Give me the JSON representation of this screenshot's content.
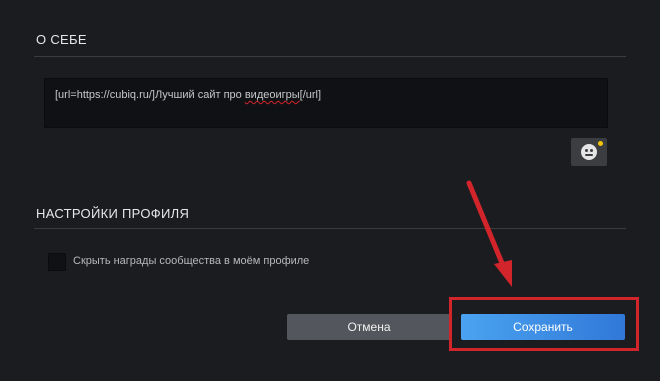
{
  "about": {
    "title": "О СЕБЕ",
    "bio_prefix": "[url=https://cubiq.ru/]Лучший сайт про ",
    "bio_underlined": "видеоигры",
    "bio_suffix": "[/url]"
  },
  "profile_settings": {
    "title": "НАСТРОЙКИ ПРОФИЛЯ",
    "hide_awards_label": "Скрыть награды сообщества в моём профиле",
    "hide_awards_checked": false
  },
  "actions": {
    "cancel_label": "Отмена",
    "save_label": "Сохранить"
  },
  "colors": {
    "background": "#1b1c1f",
    "save_button": "#3178d8",
    "annotation": "#d2252b",
    "notification_dot": "#f5c400"
  },
  "icons": {
    "emoticon": "smiley-face-icon"
  }
}
